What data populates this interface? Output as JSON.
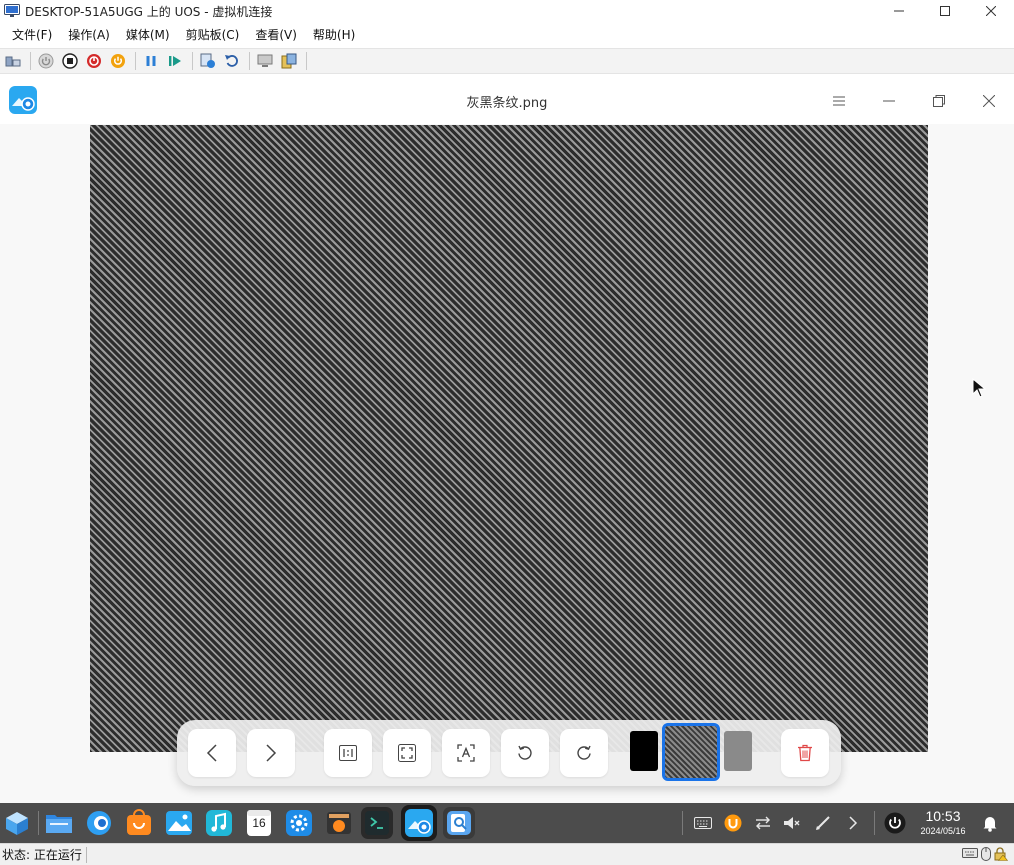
{
  "host_window": {
    "title": "DESKTOP-51A5UGG 上的 UOS - 虚拟机连接",
    "controls": [
      "minimize",
      "maximize",
      "close"
    ]
  },
  "menu": [
    {
      "label": "文件(F)"
    },
    {
      "label": "操作(A)"
    },
    {
      "label": "媒体(M)"
    },
    {
      "label": "剪贴板(C)"
    },
    {
      "label": "查看(V)"
    },
    {
      "label": "帮助(H)"
    }
  ],
  "toolbar": {
    "icons": [
      "ctrl-alt-del-icon",
      "start-icon",
      "turn-off-icon",
      "shutdown-icon",
      "reset-icon",
      "pause-icon",
      "resume-icon",
      "checkpoint-icon",
      "revert-icon",
      "enhanced-session-icon",
      "share-icon"
    ]
  },
  "viewer": {
    "file_title": "灰黑条纹.png",
    "controls": [
      "menu",
      "minimize",
      "restore",
      "close"
    ]
  },
  "viewer_toolbar": {
    "buttons": [
      "previous",
      "next",
      "original-size",
      "fit-window",
      "ocr",
      "rotate-left",
      "rotate-right",
      "delete"
    ],
    "thumbnails": [
      "black",
      "striped-selected",
      "gray"
    ],
    "selected_color": "#1a73e8",
    "delete_color": "#e04848"
  },
  "taskbar": {
    "apps": [
      "launcher",
      "file-manager",
      "browser",
      "app-store",
      "image-viewer",
      "music",
      "calendar",
      "control-center",
      "screen-recorder",
      "terminal",
      "image-viewer-active",
      "search"
    ],
    "calendar_day": "16",
    "time": "10:53",
    "date": "2024/05/16"
  },
  "statusbar": {
    "text": "状态: 正在运行"
  }
}
